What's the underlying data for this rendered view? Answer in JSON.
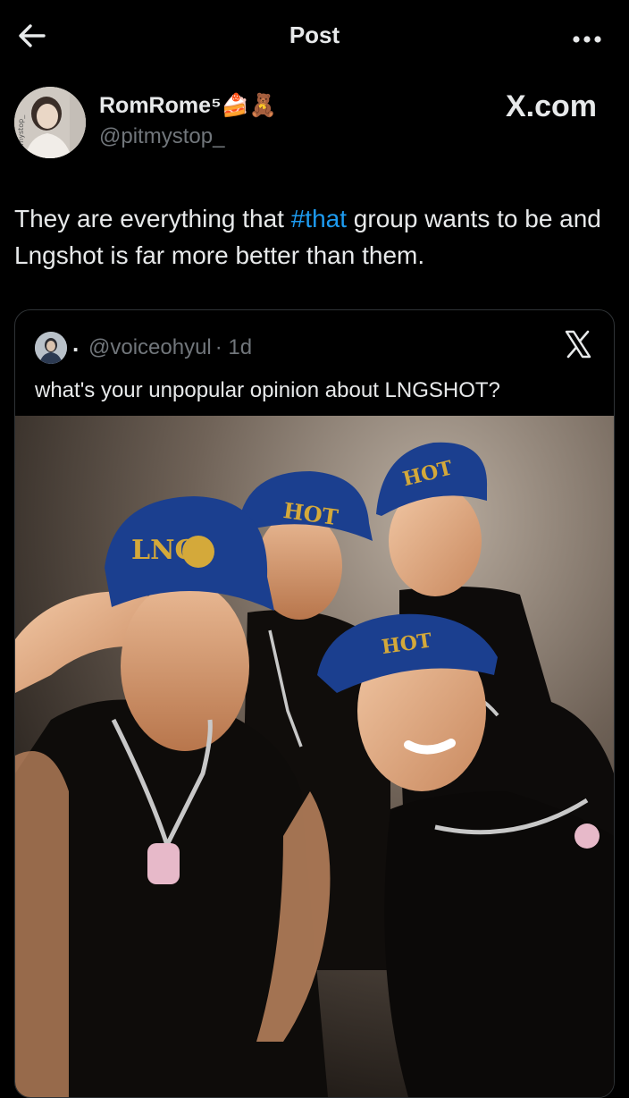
{
  "header": {
    "title": "Post",
    "back_icon": "arrow-left-icon",
    "more_icon": "more-horizontal-icon"
  },
  "author": {
    "display_name": "RomRome⁵🍰🧸",
    "handle": "@pitmystop_",
    "avatar_watermark": "pitmystop_"
  },
  "brand_watermark": "X.com",
  "post": {
    "text_before_hashtag": "They are everything that ",
    "hashtag": "#that",
    "text_after_hashtag": " group wants to be and Lngshot is far more better than them."
  },
  "quoted_post": {
    "separator": ".",
    "handle": "@voiceohyul",
    "time": "· 1d",
    "text": "what's your unpopular opinion about LNGSHOT?",
    "x_logo_icon": "x-logo-icon",
    "photo_description_icon": "group-photo-image",
    "cap_texts": [
      "LNG",
      "HOT",
      "HOT",
      "HOT"
    ]
  },
  "colors": {
    "background": "#000000",
    "text": "#e7e9ea",
    "muted": "#71767b",
    "link": "#1d9bf0",
    "border": "#2f3336",
    "cap_blue": "#1b3f8f",
    "cap_gold": "#d4a93a"
  }
}
